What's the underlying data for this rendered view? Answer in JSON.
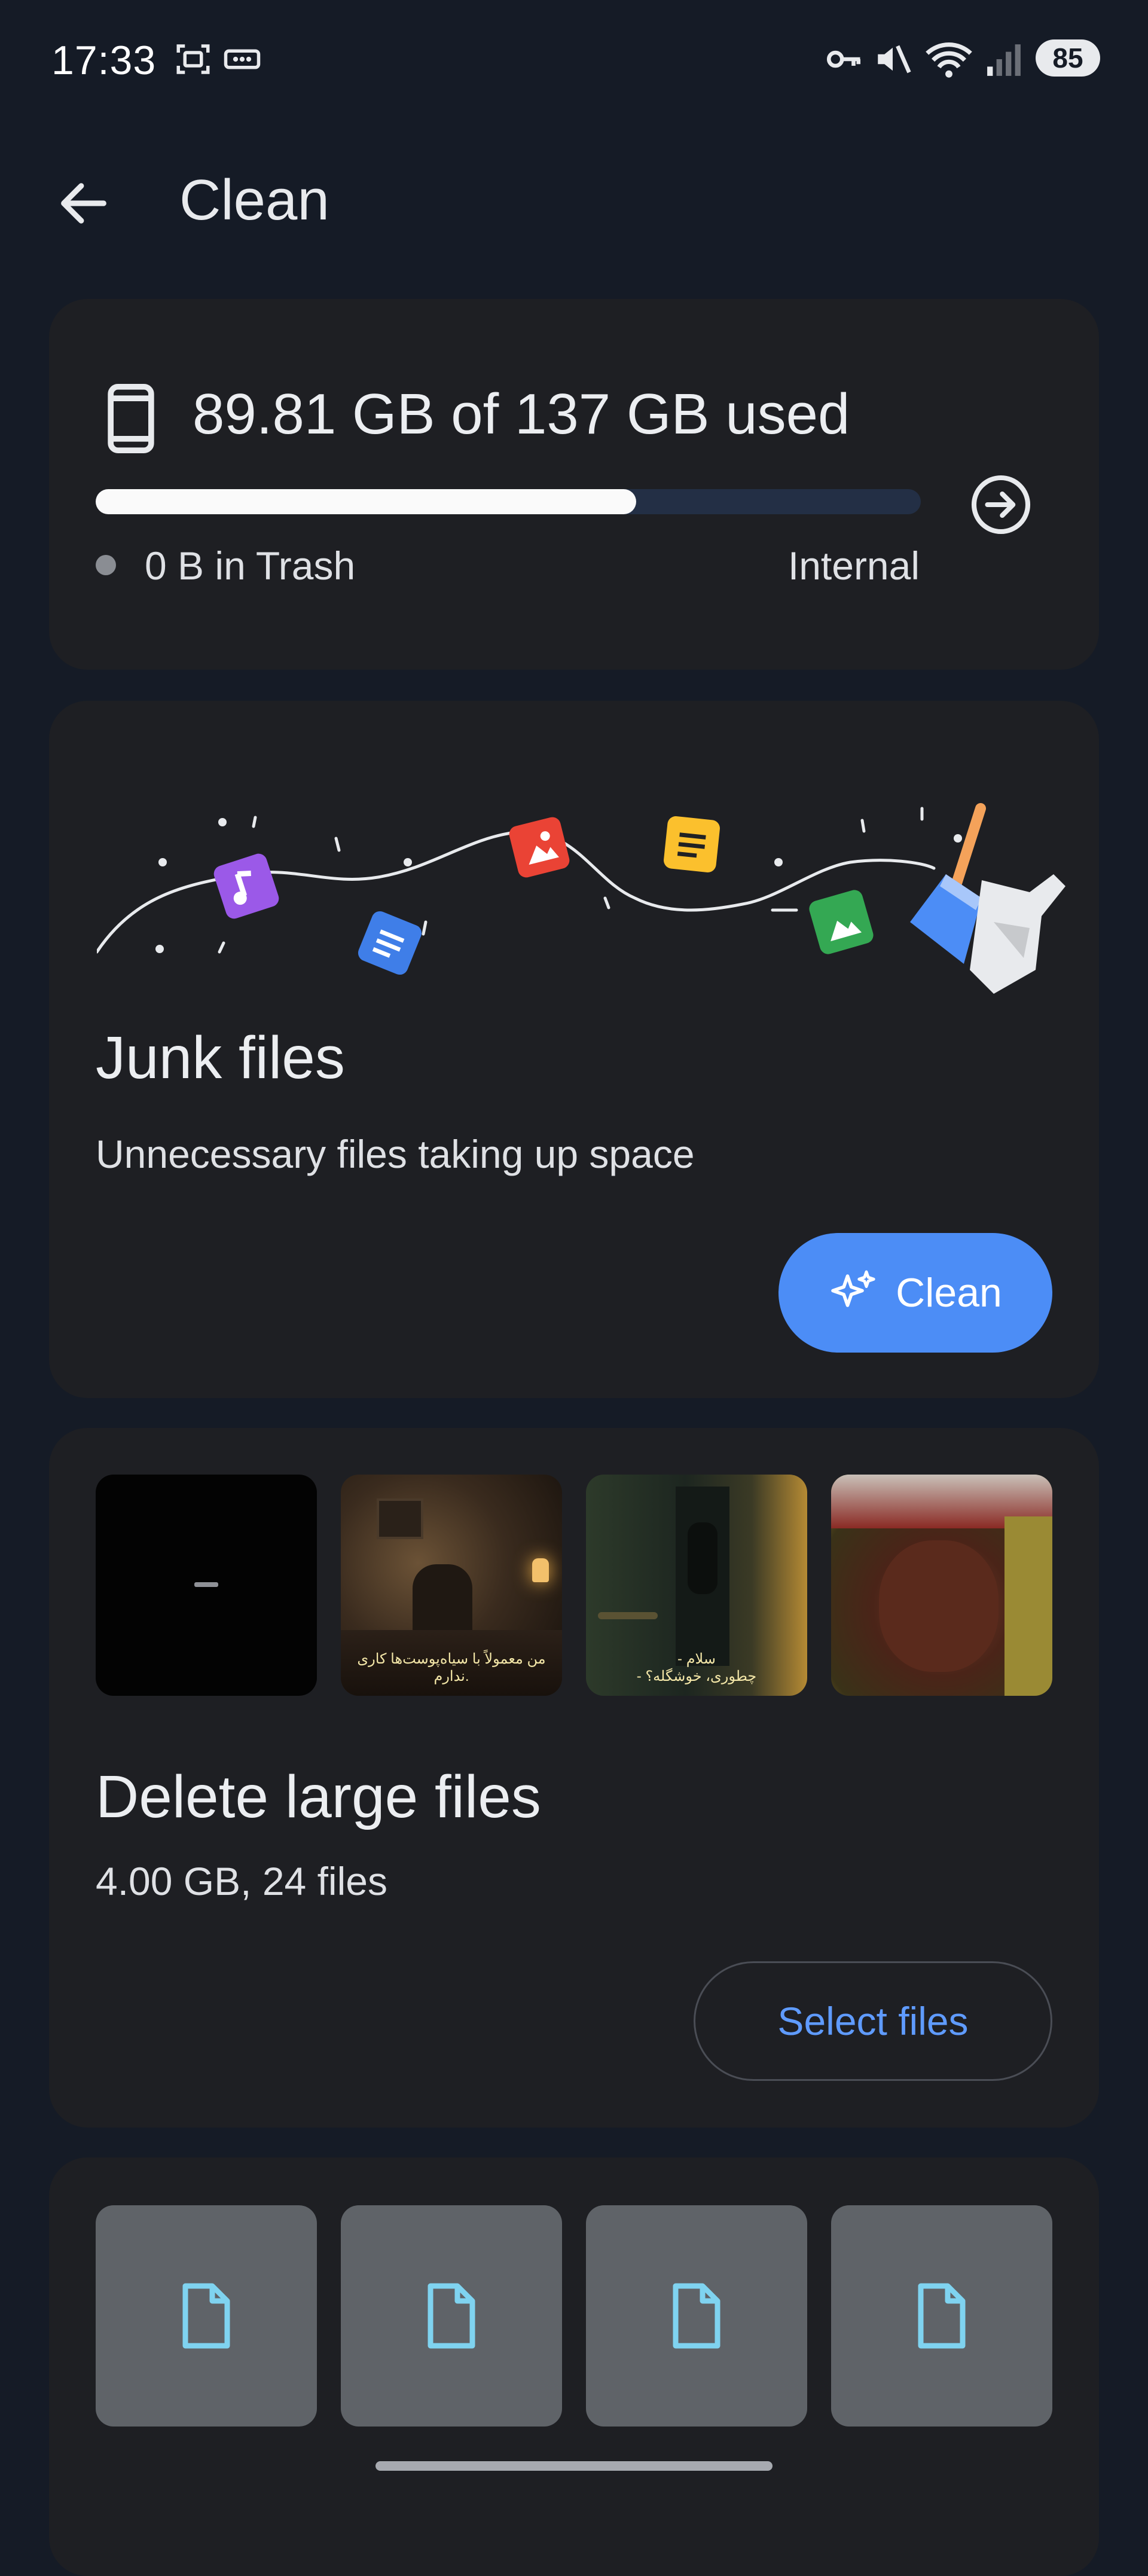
{
  "status_bar": {
    "time": "17:33",
    "battery": "85",
    "icons": [
      "screenshot-icon",
      "cast-icon",
      "key-icon",
      "mute-icon",
      "wifi-icon",
      "signal-icon"
    ]
  },
  "app_bar": {
    "title": "Clean",
    "back_icon": "back-arrow-icon"
  },
  "storage": {
    "used_label": "89.81 GB of 137 GB used",
    "used_fraction": 0.655,
    "trash_label": "0 B in Trash",
    "location_label": "Internal",
    "icons": [
      "phone-icon",
      "arrow-circle-icon"
    ]
  },
  "junk": {
    "title": "Junk files",
    "subtitle": "Unnecessary files taking up space",
    "clean_button": "Clean",
    "icons": [
      "music-file-icon",
      "doc-file-icon",
      "image-file-icon",
      "note-file-icon",
      "photo-file-icon",
      "broom-icon",
      "sparkle-icon"
    ]
  },
  "large_files": {
    "title": "Delete large files",
    "subtitle": "4.00 GB, 24 files",
    "select_button": "Select files",
    "thumbnails": [
      {
        "caption": ""
      },
      {
        "caption": "من معمولاً با سیاه‌پوست‌ها کاری ندارم."
      },
      {
        "caption": "- سلام\n- چطوری، خوشگله؟"
      },
      {
        "caption": ""
      }
    ]
  },
  "bottom_card": {
    "tiles": [
      "document-icon",
      "document-icon",
      "document-icon",
      "document-icon"
    ]
  },
  "colors": {
    "background": "#151b26",
    "card": "#1e1f23",
    "accent": "#4c8df6",
    "link": "#5f9bff"
  }
}
